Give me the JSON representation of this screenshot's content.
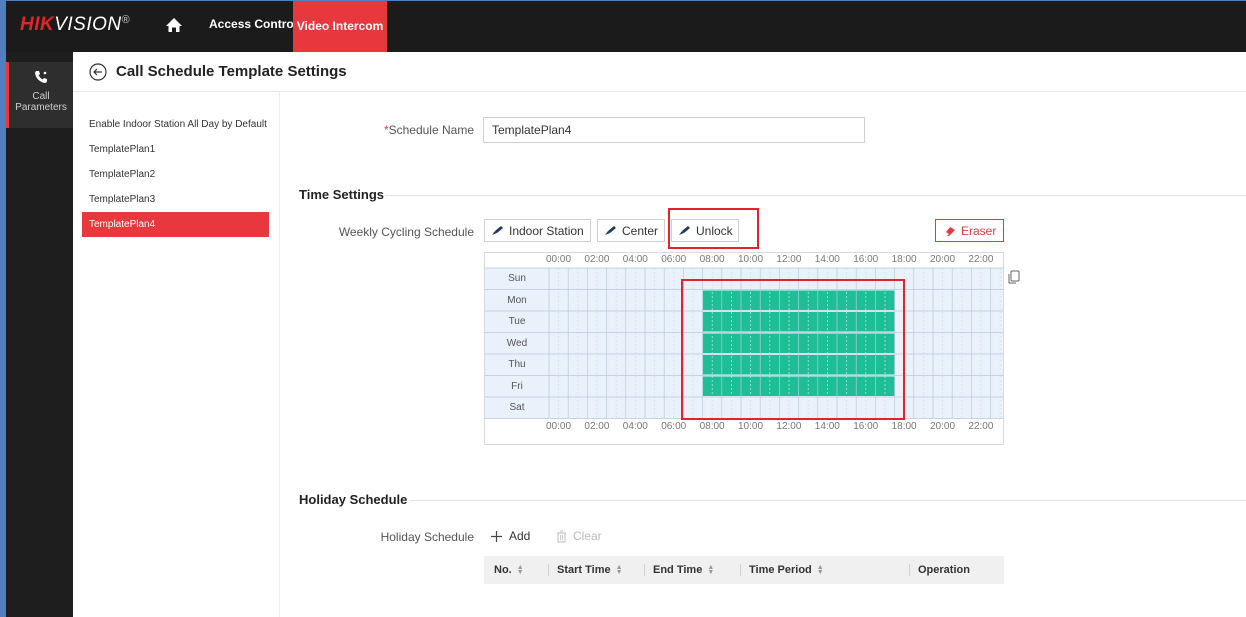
{
  "app": {
    "logo_brand": "HIK",
    "logo_rest": "VISION",
    "logo_reg": "®"
  },
  "topnav": {
    "items": [
      {
        "label": "Access Control",
        "active": false
      },
      {
        "label": "Video Intercom",
        "active": true
      }
    ]
  },
  "sidebar": {
    "items": [
      {
        "label_line1": "Call",
        "label_line2": "Parameters",
        "icon": "phone-icon",
        "active": true
      }
    ]
  },
  "page": {
    "title": "Call Schedule Template Settings"
  },
  "templates": [
    {
      "label": "Enable Indoor Station All Day by Default",
      "active": false
    },
    {
      "label": "TemplatePlan1",
      "active": false
    },
    {
      "label": "TemplatePlan2",
      "active": false
    },
    {
      "label": "TemplatePlan3",
      "active": false
    },
    {
      "label": "TemplatePlan4",
      "active": true
    }
  ],
  "form": {
    "required_mark": "*",
    "schedule_name_label": "Schedule Name",
    "schedule_name_value": "TemplatePlan4"
  },
  "time_settings": {
    "section_title": "Time Settings",
    "weekly_label": "Weekly Cycling Schedule",
    "tools": [
      {
        "label": "Indoor Station",
        "icon": "brush-icon"
      },
      {
        "label": "Center",
        "icon": "brush-icon"
      },
      {
        "label": "Unlock",
        "icon": "brush-icon"
      }
    ],
    "eraser_label": "Eraser",
    "hour_labels": [
      "00:00",
      "02:00",
      "04:00",
      "06:00",
      "08:00",
      "10:00",
      "12:00",
      "14:00",
      "16:00",
      "18:00",
      "20:00",
      "22:00"
    ],
    "days": [
      "Sun",
      "Mon",
      "Tue",
      "Wed",
      "Thu",
      "Fri",
      "Sat"
    ],
    "filled_color": "#1dbf96",
    "schedule": [
      {
        "day": "Mon",
        "start": "08:00",
        "end": "18:00"
      },
      {
        "day": "Tue",
        "start": "08:00",
        "end": "18:00"
      },
      {
        "day": "Wed",
        "start": "08:00",
        "end": "18:00"
      },
      {
        "day": "Thu",
        "start": "08:00",
        "end": "18:00"
      },
      {
        "day": "Fri",
        "start": "08:00",
        "end": "18:00"
      }
    ]
  },
  "holiday": {
    "section_title": "Holiday Schedule",
    "label": "Holiday Schedule",
    "add_label": "Add",
    "clear_label": "Clear",
    "columns": [
      "No.",
      "Start Time",
      "End Time",
      "Time Period",
      "Operation"
    ]
  },
  "colors": {
    "accent": "#e8383d",
    "highlight_box": "#e2232a"
  }
}
